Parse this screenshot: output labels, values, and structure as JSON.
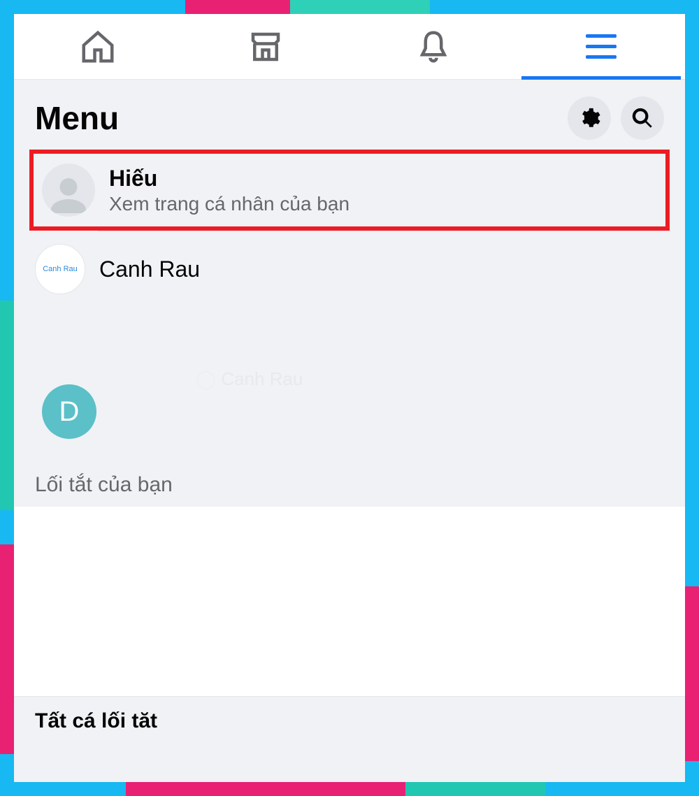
{
  "header": {
    "title": "Menu"
  },
  "profile": {
    "name": "Hiếu",
    "subtitle": "Xem trang cá nhân của bạn"
  },
  "pages": [
    {
      "label": "Canh Rau",
      "badge_text": "Canh Rau"
    }
  ],
  "d_item": {
    "letter": "D"
  },
  "watermark": "Canh Rau",
  "sections": {
    "shortcuts": "Lối tắt của bạn",
    "all_shortcuts": "Tất cá lối tăt"
  },
  "colors": {
    "accent": "#1877f2",
    "highlight_border": "#ed1c24"
  }
}
